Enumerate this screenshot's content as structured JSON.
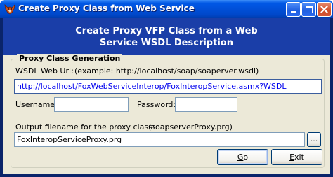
{
  "window": {
    "title": "Create Proxy Class from Web Service"
  },
  "banner": {
    "line1": "Create Proxy VFP Class from a Web",
    "line2": "Service WSDL Description"
  },
  "group": {
    "legend": "Proxy Class Generation"
  },
  "wsdl": {
    "label": "WSDL Web Url:",
    "example": "(example: http://localhost/soap/soaperver.wsdl)",
    "value": "http://localhost/FoxWebServiceInterop/FoxInteropService.asmx?WSDL"
  },
  "credentials": {
    "username_label": "Username:",
    "username_value": "",
    "password_label": "Password:",
    "password_value": ""
  },
  "output": {
    "label": "Output filename for the proxy class:",
    "example": "(soapserverProxy.prg)",
    "value": "FoxInteropServiceProxy.prg",
    "browse_label": "..."
  },
  "buttons": {
    "go_first": "G",
    "go_rest": "o",
    "exit_first": "E",
    "exit_rest": "xit"
  }
}
